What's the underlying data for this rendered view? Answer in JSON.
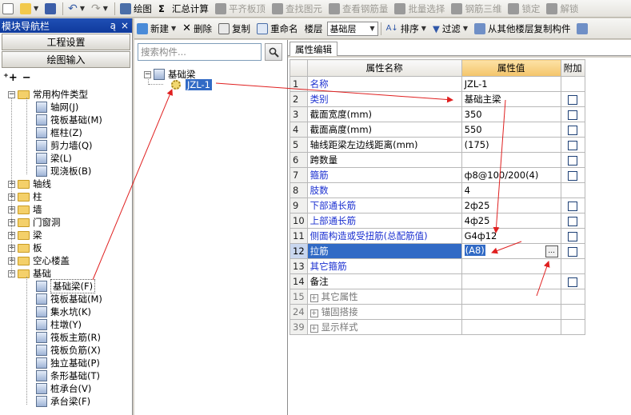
{
  "toolbar1": {
    "items": [
      {
        "label": "绘图",
        "icon": "draw-icon"
      },
      {
        "label": "汇总计算",
        "icon": "sigma-icon"
      },
      {
        "label": "平齐板顶",
        "icon": "align-icon",
        "disabled": true
      },
      {
        "label": "查找图元",
        "icon": "find-icon",
        "disabled": true
      },
      {
        "label": "查看钢筋量",
        "icon": "rebar-view-icon",
        "disabled": true
      },
      {
        "label": "批量选择",
        "icon": "batch-select-icon",
        "disabled": true
      },
      {
        "label": "钢筋三维",
        "icon": "rebar-3d-icon",
        "disabled": true
      },
      {
        "label": "锁定",
        "icon": "lock-icon",
        "disabled": true
      },
      {
        "label": "解锁",
        "icon": "unlock-icon",
        "disabled": true
      }
    ]
  },
  "toolbar2": {
    "new": "新建",
    "delete": "删除",
    "copy": "复制",
    "rename": "重命名",
    "floor_label": "楼层",
    "floor_value": "基础层",
    "sort": "排序",
    "filter": "过滤",
    "copy_from_floor": "从其他楼层复制构件"
  },
  "nav": {
    "title": "模块导航栏",
    "pin": "ą",
    "close": "×",
    "btn_project": "工程设置",
    "btn_draw": "绘图输入",
    "tree": [
      {
        "label": "常用构件类型",
        "level": 0,
        "type": "folder",
        "expanded": true
      },
      {
        "label": "轴网(J)",
        "level": 1,
        "type": "node"
      },
      {
        "label": "筏板基础(M)",
        "level": 1,
        "type": "node"
      },
      {
        "label": "框柱(Z)",
        "level": 1,
        "type": "node"
      },
      {
        "label": "剪力墙(Q)",
        "level": 1,
        "type": "node"
      },
      {
        "label": "梁(L)",
        "level": 1,
        "type": "node"
      },
      {
        "label": "现浇板(B)",
        "level": 1,
        "type": "node"
      },
      {
        "label": "轴线",
        "level": 0,
        "type": "folder",
        "expanded": false
      },
      {
        "label": "柱",
        "level": 0,
        "type": "folder",
        "expanded": false
      },
      {
        "label": "墙",
        "level": 0,
        "type": "folder",
        "expanded": false
      },
      {
        "label": "门窗洞",
        "level": 0,
        "type": "folder",
        "expanded": false
      },
      {
        "label": "梁",
        "level": 0,
        "type": "folder",
        "expanded": false
      },
      {
        "label": "板",
        "level": 0,
        "type": "folder",
        "expanded": false
      },
      {
        "label": "空心楼盖",
        "level": 0,
        "type": "folder",
        "expanded": false
      },
      {
        "label": "基础",
        "level": 0,
        "type": "folder",
        "expanded": true
      },
      {
        "label": "基础梁(F)",
        "level": 1,
        "type": "node",
        "selected": true
      },
      {
        "label": "筏板基础(M)",
        "level": 1,
        "type": "node"
      },
      {
        "label": "集水坑(K)",
        "level": 1,
        "type": "node"
      },
      {
        "label": "柱墩(Y)",
        "level": 1,
        "type": "node"
      },
      {
        "label": "筏板主筋(R)",
        "level": 1,
        "type": "node"
      },
      {
        "label": "筏板负筋(X)",
        "level": 1,
        "type": "node"
      },
      {
        "label": "独立基础(P)",
        "level": 1,
        "type": "node"
      },
      {
        "label": "条形基础(T)",
        "level": 1,
        "type": "node"
      },
      {
        "label": "桩承台(V)",
        "level": 1,
        "type": "node"
      },
      {
        "label": "承台梁(F)",
        "level": 1,
        "type": "node"
      }
    ]
  },
  "mid": {
    "search_placeholder": "搜索构件...",
    "root": "基础梁",
    "child": "JZL-1"
  },
  "props": {
    "tab": "属性编辑",
    "headers": {
      "name": "属性名称",
      "value": "属性值",
      "extra": "附加"
    },
    "rows": [
      {
        "no": "1",
        "name": "名称",
        "value": "JZL-1",
        "blue": true,
        "check": false
      },
      {
        "no": "2",
        "name": "类别",
        "value": "基础主梁",
        "blue": true,
        "check": true
      },
      {
        "no": "3",
        "name": "截面宽度(mm)",
        "value": "350",
        "blue": false,
        "check": true
      },
      {
        "no": "4",
        "name": "截面高度(mm)",
        "value": "550",
        "blue": false,
        "check": true
      },
      {
        "no": "5",
        "name": "轴线距梁左边线距离(mm)",
        "value": "(175)",
        "blue": false,
        "check": true
      },
      {
        "no": "6",
        "name": "跨数量",
        "value": "",
        "blue": false,
        "check": true
      },
      {
        "no": "7",
        "name": "箍筋",
        "value": "ф8@100/200(4)",
        "blue": true,
        "check": true
      },
      {
        "no": "8",
        "name": "肢数",
        "value": "4",
        "blue": true,
        "check": false
      },
      {
        "no": "9",
        "name": "下部通长筋",
        "value": "2ф25",
        "blue": true,
        "check": true
      },
      {
        "no": "10",
        "name": "上部通长筋",
        "value": "4ф25",
        "blue": true,
        "check": true
      },
      {
        "no": "11",
        "name": "侧面构造或受扭筋(总配筋值)",
        "value": "G4ф12",
        "blue": true,
        "check": true
      },
      {
        "no": "12",
        "name": "拉筋",
        "value": "(A8)",
        "blue": true,
        "check": true,
        "selected": true
      },
      {
        "no": "13",
        "name": "其它箍筋",
        "value": "",
        "blue": true,
        "check": false
      },
      {
        "no": "14",
        "name": "备注",
        "value": "",
        "blue": false,
        "check": true
      }
    ],
    "groups": [
      {
        "no": "15",
        "name": "其它属性"
      },
      {
        "no": "24",
        "name": "锚固搭接"
      },
      {
        "no": "39",
        "name": "显示样式"
      }
    ],
    "ellipsis": "..."
  },
  "colors": {
    "annotation": "#e02020",
    "selection": "#316ac5",
    "nav_title": "#1f4fb5"
  }
}
